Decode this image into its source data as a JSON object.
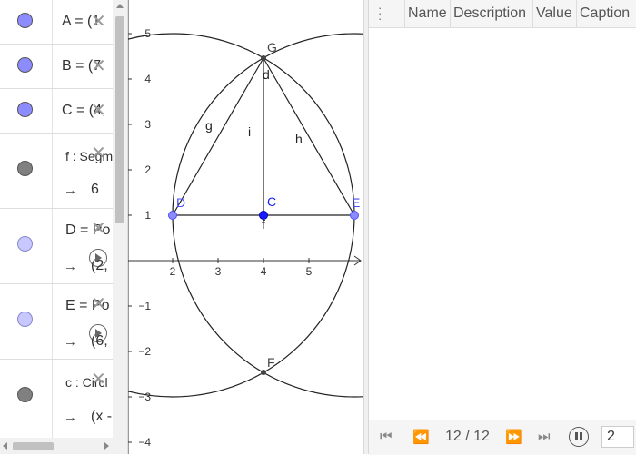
{
  "algebra": {
    "items": [
      {
        "color": "#8c8cff",
        "definition": "A = (1",
        "value": ""
      },
      {
        "color": "#8c8cff",
        "definition": "B = (7",
        "value": ""
      },
      {
        "color": "#8c8cff",
        "definition": "C = (4,",
        "value": ""
      },
      {
        "color": "#808080",
        "definition": "f : Segm",
        "value": "6"
      },
      {
        "color": "#c8c8ff",
        "definition": "D = Po",
        "value": "(2,"
      },
      {
        "color": "#c8c8ff",
        "definition": "E = Po",
        "value": "(6,"
      },
      {
        "color": "#808080",
        "definition": "c : Circl",
        "value": "(x -"
      }
    ],
    "arrow": "→",
    "close_glyph": "✕"
  },
  "graphics": {
    "x_ticks": [
      "2",
      "3",
      "4",
      "5"
    ],
    "y_ticks": [
      "5",
      "4",
      "3",
      "2",
      "1",
      "−1",
      "−2",
      "−3",
      "−4"
    ],
    "point_labels": {
      "G": "G",
      "C": "C",
      "D": "D",
      "E": "E",
      "F": "F"
    },
    "object_labels": {
      "g": "g",
      "h": "h",
      "i": "i",
      "d": "d",
      "f": "f"
    },
    "colors": {
      "point": "#4d4dff",
      "point_fill": "#8c8cff",
      "line": "#222222"
    }
  },
  "protocol": {
    "columns": [
      "Name",
      "Description",
      "Value",
      "Caption"
    ],
    "navigation": {
      "page_info": "12 / 12",
      "speed": "2"
    }
  }
}
